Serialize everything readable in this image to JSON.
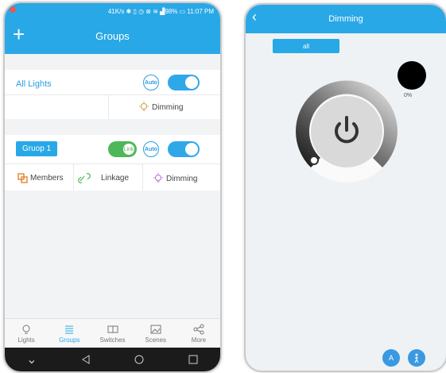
{
  "status": {
    "speed": "41K/s",
    "battery": "98%",
    "time": "11:07 PM"
  },
  "left": {
    "title": "Groups",
    "all_lights": {
      "label": "All Lights",
      "auto": "Auto",
      "dimming": "Dimming"
    },
    "group1": {
      "label": "Gruop 1",
      "link": "Link",
      "auto": "Auto",
      "members": "Members",
      "linkage": "Linkage",
      "dimming": "Dimming"
    },
    "tabs": [
      {
        "label": "Lights",
        "icon": "bulb-icon"
      },
      {
        "label": "Groups",
        "icon": "groups-icon"
      },
      {
        "label": "Switches",
        "icon": "switches-icon"
      },
      {
        "label": "Scenes",
        "icon": "scenes-icon"
      },
      {
        "label": "More",
        "icon": "share-icon"
      }
    ]
  },
  "right": {
    "title": "Dimming",
    "all_label": "all",
    "percent": "0%",
    "brightness": 0,
    "accent": "#29a8e7"
  }
}
